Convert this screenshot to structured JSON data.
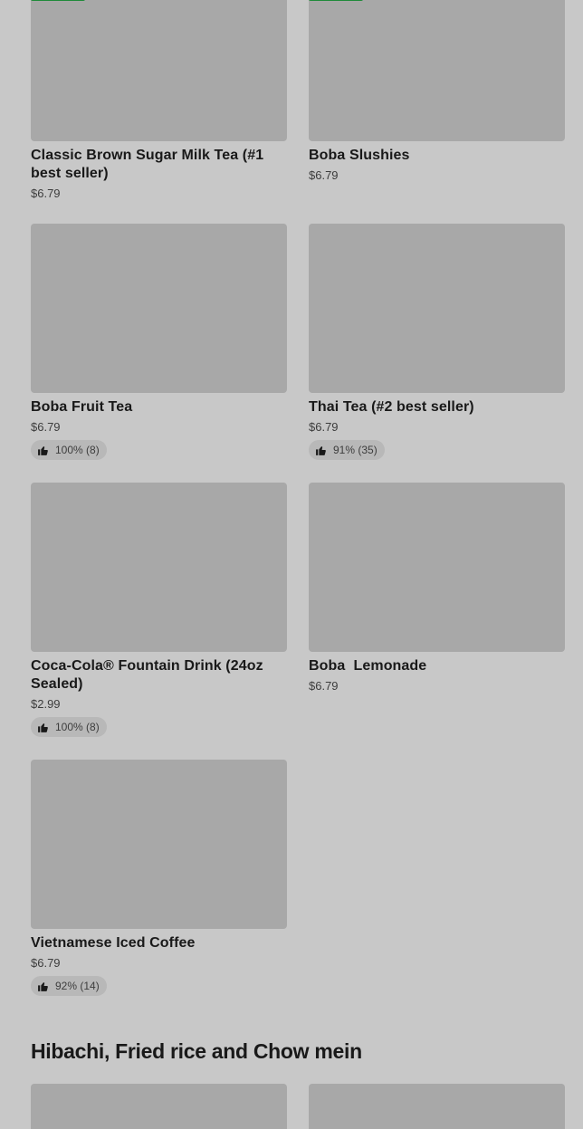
{
  "items": [
    {
      "name": "Classic Brown Sugar Milk Tea (#1 best seller)",
      "price": "$6.79"
    },
    {
      "name": "Boba Slushies",
      "price": "$6.79"
    },
    {
      "name": "Boba Fruit Tea",
      "price": "$6.79",
      "rating": "100% (8)"
    },
    {
      "name": "Thai Tea (#2 best seller)",
      "price": "$6.79",
      "rating": "91% (35)"
    },
    {
      "name": "Coca-Cola® Fountain Drink (24oz Sealed)",
      "price": "$2.99",
      "rating": "100% (8)"
    },
    {
      "name": "Boba  Lemonade",
      "price": "$6.79"
    },
    {
      "name": "Vietnamese Iced Coffee",
      "price": "$6.79",
      "rating": "92% (14)"
    }
  ],
  "next_section": {
    "title": "Hibachi, Fried rice and Chow mein"
  },
  "colors": {
    "badge": "#1f8a3a",
    "image_placeholder": "#a8a8a8",
    "background": "#c8c8c8"
  },
  "icons": {
    "rating": "thumbs-up-icon"
  }
}
